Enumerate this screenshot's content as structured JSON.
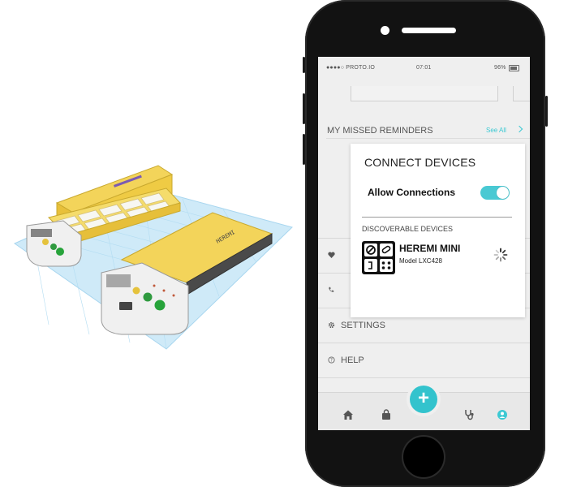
{
  "status_bar": {
    "carrier": "●●●●○ PROTO.IO",
    "time": "07:01",
    "battery": "96%"
  },
  "missed_reminders": {
    "title": "MY MISSED REMINDERS",
    "see_all": "See All"
  },
  "menu": {
    "items": [
      {
        "label": "",
        "icon": "heart-icon"
      },
      {
        "label": "",
        "icon": "phone-icon"
      },
      {
        "label": "SETTINGS",
        "icon": "gear-icon"
      },
      {
        "label": "HELP",
        "icon": "help-icon"
      }
    ]
  },
  "popup": {
    "title": "CONNECT DEVICES",
    "allow_label": "Allow Connections",
    "allow_enabled": true,
    "discoverable_label": "DISCOVERABLE DEVICES",
    "device": {
      "name": "HEREMI MINI",
      "model": "Model LXC428",
      "icon": "heremi-logo-icon"
    }
  },
  "product_label": "HEREMI",
  "tabbar": {
    "items": [
      "home-icon",
      "bag-icon",
      "stethoscope-icon",
      "profile-icon"
    ],
    "add_label": "+"
  },
  "colors": {
    "accent": "#3cc9d3",
    "device_yellow": "#f3d45a",
    "grid_blue": "#bfe3f5"
  }
}
